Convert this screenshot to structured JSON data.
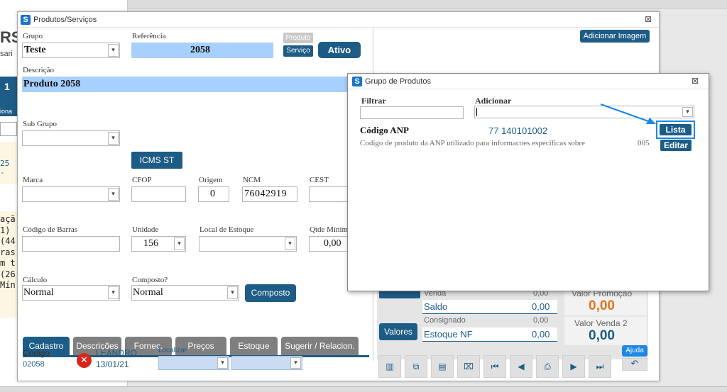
{
  "background": {
    "frag_rs": "RS",
    "frag_sari": "sari",
    "frag_1": "1",
    "frag_iona": "iona",
    "frag_25": "25 -",
    "frag_lines": [
      "açã",
      "1)",
      "(44",
      "ras",
      "m t",
      "(26",
      "Mín"
    ]
  },
  "window": {
    "title": "Produtos/Serviços",
    "close_glyph": "⊠"
  },
  "form": {
    "grupo_label": "Grupo",
    "grupo_value": "Teste",
    "referencia_label": "Referência",
    "referencia_value": "2058",
    "produto_btn": "Produto",
    "servico_btn": "Serviço",
    "ativo_btn": "Ativo",
    "descricao_label": "Descrição",
    "descricao_value": "Produto 2058",
    "subgrupo_label": "Sub Grupo",
    "icms_btn": "ICMS ST",
    "marca_label": "Marca",
    "cfop_label": "CFOP",
    "origem_label": "Origem",
    "origem_value": "0",
    "ncm_label": "NCM",
    "ncm_value": "76042919",
    "cest_label": "CEST",
    "codbarras_label": "Código de Barras",
    "unidade_label": "Unidade",
    "unidade_value": "156",
    "localestoque_label": "Local de Estoque",
    "qtdemin_label": "Qtde Mínim",
    "qtdemin_value": "0,00",
    "calculo_label": "Cálculo",
    "calculo_value": "Normal",
    "composto_label": "Composto?",
    "composto_value": "Normal",
    "composto_btn": "Composto",
    "adicionar_imagem_btn": "Adicionar Imagem"
  },
  "tabs": [
    "Cadastro",
    "Descrições",
    "Fornec.",
    "Preços",
    "Estoque",
    "Sugerir / Relacion."
  ],
  "footer": {
    "codigo_label": "Código",
    "codigo_value": "02058",
    "user_name": "LEANDRO",
    "user_date": "13/01/21",
    "localizar_label": "Localizar"
  },
  "right_panel": {
    "venda_label": "Venda",
    "venda_value": "0,00",
    "saldo_label": "Saldo",
    "saldo_value": "0,00",
    "consignado_label": "Consignado",
    "consignado_value": "0,00",
    "estoque_nf_label": "Estoque NF",
    "estoque_nf_value": "0,00",
    "valores_btn": "Valores",
    "valor_promocao_label": "Valor Promoção",
    "valor_promocao_value": "0,00",
    "valor_venda2_label": "Valor Venda 2",
    "valor_venda2_value": "0,00",
    "ajuda_btn": "Ajuda"
  },
  "dialog": {
    "title": "Grupo de Produtos",
    "close_glyph": "⊠",
    "filtrar_label": "Filtrar",
    "adicionar_label": "Adicionar",
    "item_name": "Código ANP",
    "item_code": "77 140101002",
    "item_desc": "Codigo de produto da ANP utilizado para informacoes especificas sobre",
    "item_num": "005",
    "lista_btn": "Lista",
    "editar_btn": "Editar",
    "arrow_color": "#1e88e5"
  },
  "colors": {
    "accent_dark": "#1d5c86",
    "field_blue": "#a7d0ff",
    "orange": "#e2731d"
  }
}
